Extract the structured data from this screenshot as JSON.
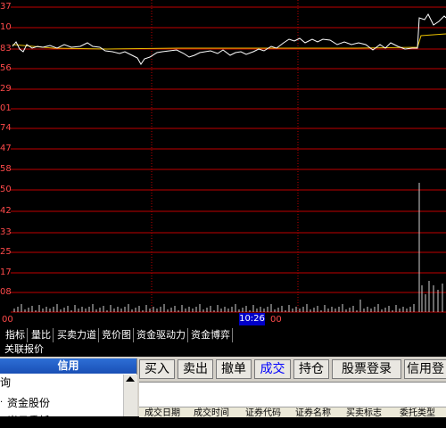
{
  "chart": {
    "price_labels": [
      "37",
      "10",
      "83",
      "56",
      "29",
      "01",
      "74",
      "47",
      "58",
      "50",
      "42",
      "33",
      "25",
      "17",
      "08"
    ],
    "time_ticks": [
      "00",
      "10:26",
      "00"
    ],
    "colors": {
      "grid": "#c00000",
      "price_line": "#ffffff",
      "avg_line": "#e8c000",
      "volume": "#d0d0d0",
      "axis_text": "#ff4a4a",
      "dotted": "#c00000"
    }
  },
  "tabs": [
    "指标",
    "量比",
    "买卖力道",
    "竞价图",
    "资金驱动力",
    "资金博弈"
  ],
  "related_label": "关联报价",
  "left_panel": {
    "header": "信用",
    "items": [
      "询",
      "资金股份",
      "当日委托"
    ]
  },
  "toolbar": {
    "buttons": [
      "买入",
      "卖出",
      "撤单",
      "成交",
      "持仓",
      "股票登录",
      "信用登"
    ],
    "active_button": "成交"
  },
  "table_headers": [
    "成交日期",
    "成交时间",
    "证券代码",
    "证券名称",
    "买卖标志",
    "委托类型"
  ]
}
